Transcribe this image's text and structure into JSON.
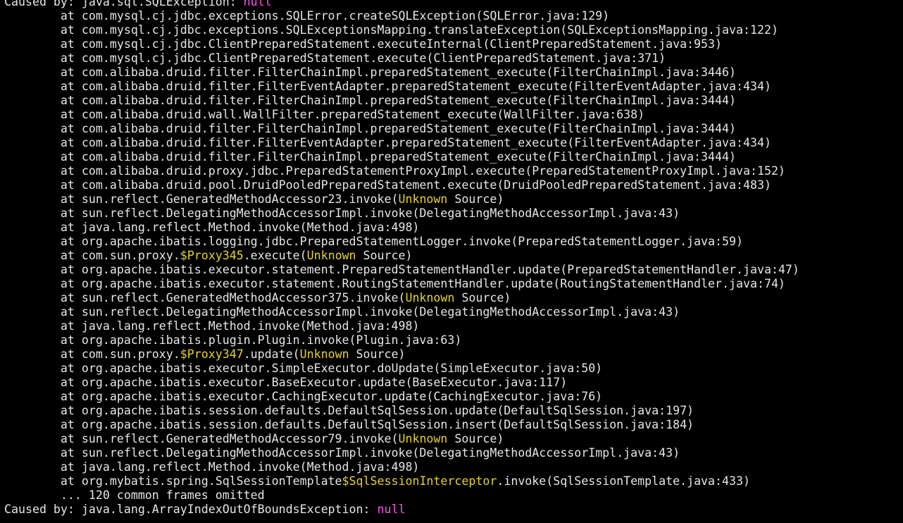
{
  "terminal": {
    "colors": {
      "background": "#000000",
      "foreground": "#e6e6e6",
      "yellow": "#e6d32c",
      "magenta": "#ff4fe8"
    },
    "lines": [
      {
        "text": "Caused by: java.sql.SQLException: null",
        "segs": [
          {
            "t": "Caused by: java.sql.SQLException: ",
            "c": ""
          },
          {
            "t": "null",
            "c": "magenta"
          }
        ]
      },
      {
        "text": "        at com.mysql.cj.jdbc.exceptions.SQLError.createSQLException(SQLError.java:129)"
      },
      {
        "text": "        at com.mysql.cj.jdbc.exceptions.SQLExceptionsMapping.translateException(SQLExceptionsMapping.java:122)"
      },
      {
        "text": "        at com.mysql.cj.jdbc.ClientPreparedStatement.executeInternal(ClientPreparedStatement.java:953)"
      },
      {
        "text": "        at com.mysql.cj.jdbc.ClientPreparedStatement.execute(ClientPreparedStatement.java:371)"
      },
      {
        "text": "        at com.alibaba.druid.filter.FilterChainImpl.preparedStatement_execute(FilterChainImpl.java:3446)"
      },
      {
        "text": "        at com.alibaba.druid.filter.FilterEventAdapter.preparedStatement_execute(FilterEventAdapter.java:434)"
      },
      {
        "text": "        at com.alibaba.druid.filter.FilterChainImpl.preparedStatement_execute(FilterChainImpl.java:3444)"
      },
      {
        "text": "        at com.alibaba.druid.wall.WallFilter.preparedStatement_execute(WallFilter.java:638)"
      },
      {
        "text": "        at com.alibaba.druid.filter.FilterChainImpl.preparedStatement_execute(FilterChainImpl.java:3444)"
      },
      {
        "text": "        at com.alibaba.druid.filter.FilterEventAdapter.preparedStatement_execute(FilterEventAdapter.java:434)"
      },
      {
        "text": "        at com.alibaba.druid.filter.FilterChainImpl.preparedStatement_execute(FilterChainImpl.java:3444)"
      },
      {
        "text": "        at com.alibaba.druid.proxy.jdbc.PreparedStatementProxyImpl.execute(PreparedStatementProxyImpl.java:152)"
      },
      {
        "text": "        at com.alibaba.druid.pool.DruidPooledPreparedStatement.execute(DruidPooledPreparedStatement.java:483)"
      },
      {
        "text": "        at sun.reflect.GeneratedMethodAccessor23.invoke(Unknown Source)",
        "segs": [
          {
            "t": "        at sun.reflect.GeneratedMethodAccessor23.invoke(",
            "c": ""
          },
          {
            "t": "Unknown",
            "c": "yellow"
          },
          {
            "t": " Source)",
            "c": ""
          }
        ]
      },
      {
        "text": "        at sun.reflect.DelegatingMethodAccessorImpl.invoke(DelegatingMethodAccessorImpl.java:43)"
      },
      {
        "text": "        at java.lang.reflect.Method.invoke(Method.java:498)"
      },
      {
        "text": "        at org.apache.ibatis.logging.jdbc.PreparedStatementLogger.invoke(PreparedStatementLogger.java:59)"
      },
      {
        "text": "        at com.sun.proxy.$Proxy345.execute(Unknown Source)",
        "segs": [
          {
            "t": "        at com.sun.proxy.",
            "c": ""
          },
          {
            "t": "$Proxy345",
            "c": "yellow"
          },
          {
            "t": ".execute(",
            "c": ""
          },
          {
            "t": "Unknown",
            "c": "yellow"
          },
          {
            "t": " Source)",
            "c": ""
          }
        ]
      },
      {
        "text": "        at org.apache.ibatis.executor.statement.PreparedStatementHandler.update(PreparedStatementHandler.java:47)"
      },
      {
        "text": "        at org.apache.ibatis.executor.statement.RoutingStatementHandler.update(RoutingStatementHandler.java:74)"
      },
      {
        "text": "        at sun.reflect.GeneratedMethodAccessor375.invoke(Unknown Source)",
        "segs": [
          {
            "t": "        at sun.reflect.GeneratedMethodAccessor375.invoke(",
            "c": ""
          },
          {
            "t": "Unknown",
            "c": "yellow"
          },
          {
            "t": " Source)",
            "c": ""
          }
        ]
      },
      {
        "text": "        at sun.reflect.DelegatingMethodAccessorImpl.invoke(DelegatingMethodAccessorImpl.java:43)"
      },
      {
        "text": "        at java.lang.reflect.Method.invoke(Method.java:498)"
      },
      {
        "text": "        at org.apache.ibatis.plugin.Plugin.invoke(Plugin.java:63)"
      },
      {
        "text": "        at com.sun.proxy.$Proxy347.update(Unknown Source)",
        "segs": [
          {
            "t": "        at com.sun.proxy.",
            "c": ""
          },
          {
            "t": "$Proxy347",
            "c": "yellow"
          },
          {
            "t": ".update(",
            "c": ""
          },
          {
            "t": "Unknown",
            "c": "yellow"
          },
          {
            "t": " Source)",
            "c": ""
          }
        ]
      },
      {
        "text": "        at org.apache.ibatis.executor.SimpleExecutor.doUpdate(SimpleExecutor.java:50)"
      },
      {
        "text": "        at org.apache.ibatis.executor.BaseExecutor.update(BaseExecutor.java:117)"
      },
      {
        "text": "        at org.apache.ibatis.executor.CachingExecutor.update(CachingExecutor.java:76)"
      },
      {
        "text": "        at org.apache.ibatis.session.defaults.DefaultSqlSession.update(DefaultSqlSession.java:197)"
      },
      {
        "text": "        at org.apache.ibatis.session.defaults.DefaultSqlSession.insert(DefaultSqlSession.java:184)"
      },
      {
        "text": "        at sun.reflect.GeneratedMethodAccessor79.invoke(Unknown Source)",
        "segs": [
          {
            "t": "        at sun.reflect.GeneratedMethodAccessor79.invoke(",
            "c": ""
          },
          {
            "t": "Unknown",
            "c": "yellow"
          },
          {
            "t": " Source)",
            "c": ""
          }
        ]
      },
      {
        "text": "        at sun.reflect.DelegatingMethodAccessorImpl.invoke(DelegatingMethodAccessorImpl.java:43)"
      },
      {
        "text": "        at java.lang.reflect.Method.invoke(Method.java:498)"
      },
      {
        "text": "        at org.mybatis.spring.SqlSessionTemplate$SqlSessionInterceptor.invoke(SqlSessionTemplate.java:433)",
        "segs": [
          {
            "t": "        at org.mybatis.spring.SqlSessionTemplate",
            "c": ""
          },
          {
            "t": "$SqlSessionInterceptor",
            "c": "yellow"
          },
          {
            "t": ".invoke(SqlSessionTemplate.java:433)",
            "c": ""
          }
        ]
      },
      {
        "text": "        ... 120 common frames omitted"
      },
      {
        "text": "Caused by: java.lang.ArrayIndexOutOfBoundsException: null",
        "segs": [
          {
            "t": "Caused by: java.lang.ArrayIndexOutOfBoundsException: ",
            "c": ""
          },
          {
            "t": "null",
            "c": "magenta"
          }
        ]
      }
    ]
  }
}
